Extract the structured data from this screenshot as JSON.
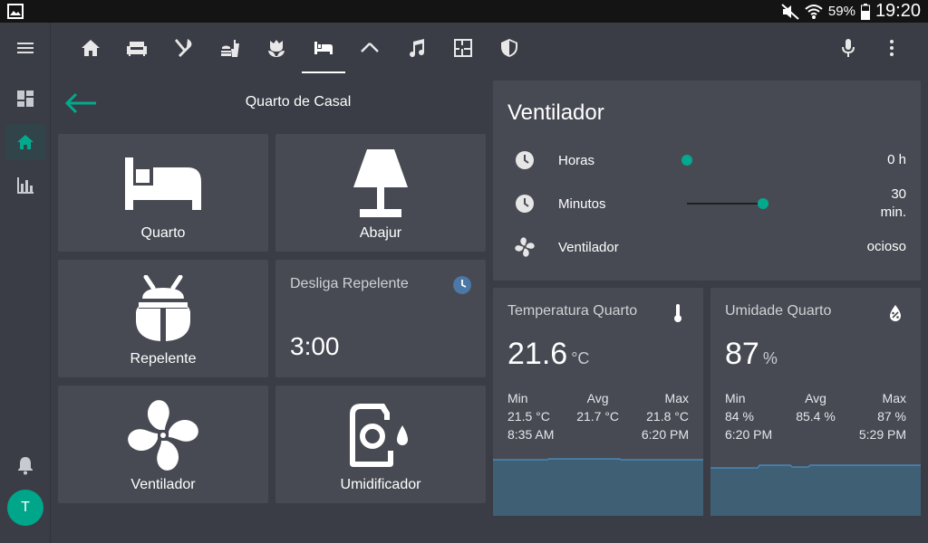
{
  "statusbar": {
    "battery": "59%",
    "time": "19:20"
  },
  "view": {
    "title": "Quarto de Casal"
  },
  "colors": {
    "accent": "#03a98d",
    "card": "#474a53",
    "background": "#3a3d46",
    "graph": "#3f5f75"
  },
  "tabs": [
    {
      "icon": "home-icon"
    },
    {
      "icon": "sofa-icon"
    },
    {
      "icon": "silverware-icon"
    },
    {
      "icon": "food-drink-icon"
    },
    {
      "icon": "flower-icon"
    },
    {
      "icon": "bed-icon",
      "active": true
    },
    {
      "icon": "roof-icon"
    },
    {
      "icon": "music-icon"
    },
    {
      "icon": "floor-plan-icon"
    },
    {
      "icon": "shield-icon"
    }
  ],
  "tiles": {
    "quarto": {
      "name": "Quarto",
      "icon": "bed-icon"
    },
    "abajur": {
      "name": "Abajur",
      "icon": "lamp-icon"
    },
    "repelente": {
      "name": "Repelente",
      "icon": "bug-icon"
    },
    "timer": {
      "name": "Desliga Repelente",
      "value": "3:00",
      "icon": "timer-icon"
    },
    "ventilador": {
      "name": "Ventilador",
      "icon": "fan-icon"
    },
    "umidificador": {
      "name": "Umidificador",
      "icon": "humidifier-icon"
    }
  },
  "fan_card": {
    "title": "Ventilador",
    "rows": [
      {
        "label": "Horas",
        "value": "0 h",
        "level": 0
      },
      {
        "label": "Minutos",
        "value": "30",
        "value2": "min.",
        "level": 1
      },
      {
        "label": "Ventilador",
        "value": "ocioso"
      }
    ]
  },
  "temperature": {
    "name": "Temperatura Quarto",
    "value": "21.6",
    "unit": "°C",
    "min_label": "Min",
    "avg_label": "Avg",
    "max_label": "Max",
    "min": "21.5 °C",
    "avg": "21.7 °C",
    "max": "21.8 °C",
    "min_time": "8:35 AM",
    "max_time": "6:20 PM"
  },
  "humidity": {
    "name": "Umidade Quarto",
    "value": "87",
    "unit": "%",
    "min_label": "Min",
    "avg_label": "Avg",
    "max_label": "Max",
    "min": "84 %",
    "avg": "85.4 %",
    "max": "87 %",
    "min_time": "6:20 PM",
    "max_time": "5:29 PM"
  },
  "user": {
    "initial": "T"
  }
}
